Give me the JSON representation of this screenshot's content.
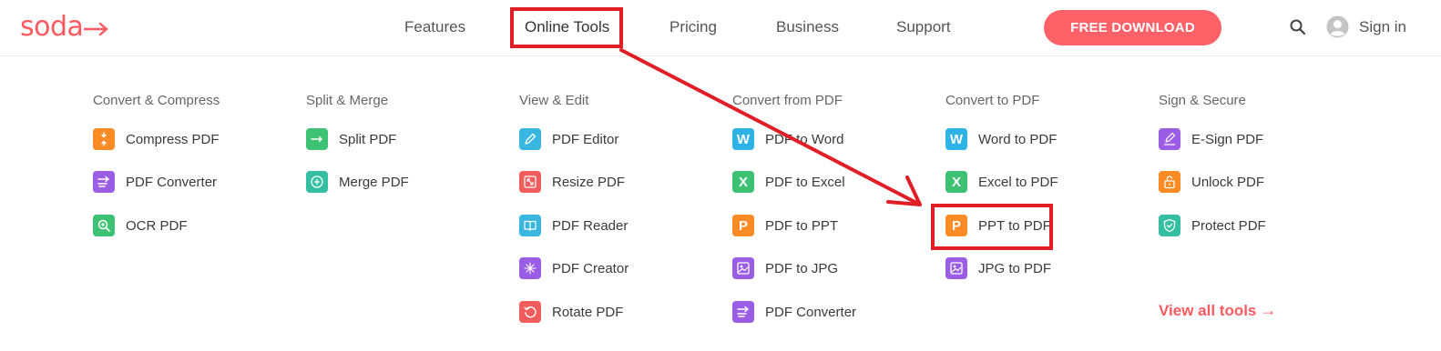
{
  "logo": {
    "text": "soda"
  },
  "nav": {
    "features": "Features",
    "online_tools": "Online Tools",
    "pricing": "Pricing",
    "business": "Business",
    "support": "Support"
  },
  "cta": {
    "label": "FREE DOWNLOAD"
  },
  "account": {
    "signin": "Sign in"
  },
  "menu": {
    "columns": [
      {
        "title": "Convert & Compress",
        "items": [
          {
            "label": "Compress PDF",
            "icon": "compress-icon",
            "color": "#fb8b24"
          },
          {
            "label": "PDF Converter",
            "icon": "convert-icon",
            "color": "#9b5de5"
          },
          {
            "label": "OCR PDF",
            "icon": "ocr-icon",
            "color": "#3dc172"
          }
        ]
      },
      {
        "title": "Split & Merge",
        "items": [
          {
            "label": "Split PDF",
            "icon": "split-icon",
            "color": "#3dc172"
          },
          {
            "label": "Merge PDF",
            "icon": "merge-icon",
            "color": "#34bfa3"
          }
        ]
      },
      {
        "title": "View & Edit",
        "items": [
          {
            "label": "PDF Editor",
            "icon": "pencil-icon",
            "color": "#3ab7e0"
          },
          {
            "label": "Resize PDF",
            "icon": "resize-icon",
            "color": "#f25c5c"
          },
          {
            "label": "PDF Reader",
            "icon": "book-icon",
            "color": "#3ab7e0"
          },
          {
            "label": "PDF Creator",
            "icon": "sparkle-icon",
            "color": "#9b5de5"
          },
          {
            "label": "Rotate PDF",
            "icon": "rotate-icon",
            "color": "#f25c5c"
          }
        ]
      },
      {
        "title": "Convert from PDF",
        "items": [
          {
            "label": "PDF to Word",
            "icon": "word-icon",
            "glyph": "W",
            "color": "#2eb3e6"
          },
          {
            "label": "PDF to Excel",
            "icon": "excel-icon",
            "glyph": "X",
            "color": "#3dc172"
          },
          {
            "label": "PDF to PPT",
            "icon": "ppt-icon",
            "glyph": "P",
            "color": "#fb8b24"
          },
          {
            "label": "PDF to JPG",
            "icon": "image-icon",
            "color": "#9b5de5"
          },
          {
            "label": "PDF Converter",
            "icon": "convert-icon",
            "color": "#9b5de5"
          }
        ]
      },
      {
        "title": "Convert to PDF",
        "items": [
          {
            "label": "Word to PDF",
            "icon": "word-icon",
            "glyph": "W",
            "color": "#2eb3e6"
          },
          {
            "label": "Excel to PDF",
            "icon": "excel-icon",
            "glyph": "X",
            "color": "#3dc172"
          },
          {
            "label": "PPT to PDF",
            "icon": "ppt-icon",
            "glyph": "P",
            "color": "#fb8b24"
          },
          {
            "label": "JPG to PDF",
            "icon": "image-icon",
            "color": "#9b5de5"
          }
        ]
      },
      {
        "title": "Sign & Secure",
        "items": [
          {
            "label": "E-Sign PDF",
            "icon": "signature-icon",
            "color": "#9b5de5"
          },
          {
            "label": "Unlock PDF",
            "icon": "unlock-icon",
            "color": "#fb8b24"
          },
          {
            "label": "Protect PDF",
            "icon": "shield-icon",
            "color": "#34bfa3"
          }
        ]
      }
    ],
    "view_all": "View all tools"
  },
  "colors": {
    "brand": "#ff5a5f",
    "annotation": "#e11d25"
  }
}
